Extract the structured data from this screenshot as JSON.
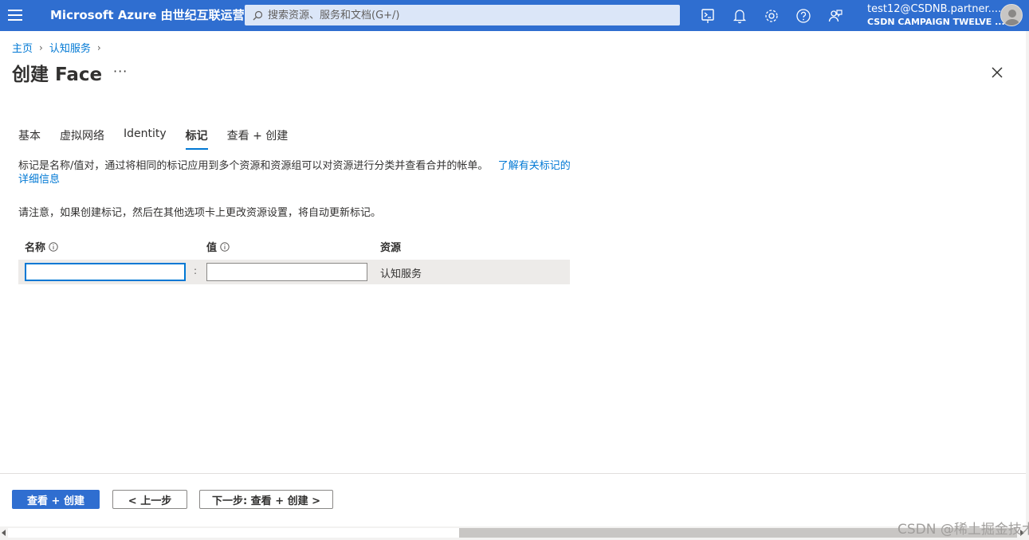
{
  "topbar": {
    "brand": "Microsoft Azure 由世纪互联运营",
    "search_placeholder": "搜索资源、服务和文档(G+/)",
    "account_email": "test12@CSDNB.partner....",
    "account_tenant": "CSDN CAMPAIGN TWELVE ...",
    "icons": [
      "menu-icon",
      "cloud-shell-icon",
      "notifications-icon",
      "settings-icon",
      "help-icon",
      "feedback-icon"
    ]
  },
  "breadcrumb": {
    "home": "主页",
    "service": "认知服务"
  },
  "page": {
    "title": "创建 Face",
    "more": "···"
  },
  "tabs": [
    {
      "label": "基本",
      "active": false
    },
    {
      "label": "虚拟网络",
      "active": false
    },
    {
      "label": "Identity",
      "active": false
    },
    {
      "label": "标记",
      "active": true
    },
    {
      "label": "查看 + 创建",
      "active": false
    }
  ],
  "content": {
    "description": "标记是名称/值对，通过将相同的标记应用到多个资源和资源组可以对资源进行分类并查看合并的帐单。",
    "learn_more_link": "了解有关标记的详细信息",
    "note": "请注意，如果创建标记，然后在其他选项卡上更改资源设置，将自动更新标记。"
  },
  "tag_grid": {
    "col_name": "名称",
    "col_value": "值",
    "col_resource": "资源",
    "row": {
      "name_value": "",
      "separator": ":",
      "value_value": "",
      "resource": "认知服务"
    }
  },
  "footer": {
    "review_create": "查看 + 创建",
    "previous": "< 上一步",
    "next": "下一步: 查看 + 创建 >"
  },
  "watermark": "CSDN @稀土掘金技术社区",
  "colors": {
    "accent": "#2f6ed0",
    "link": "#0078d4"
  }
}
